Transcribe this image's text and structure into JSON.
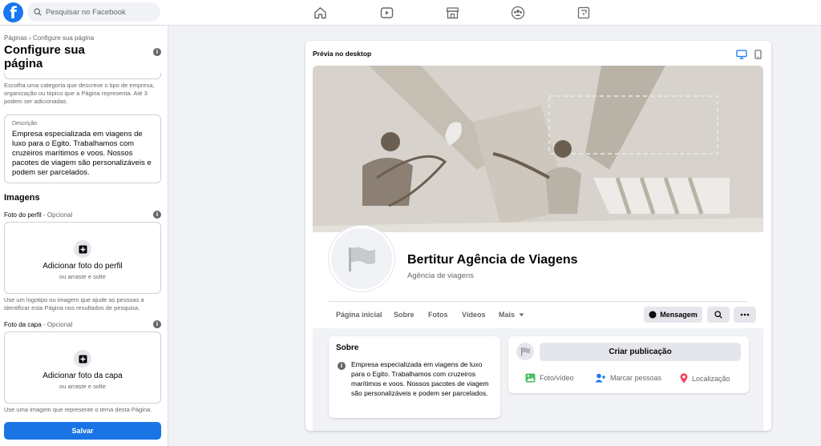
{
  "topbar": {
    "logo": "f",
    "search_placeholder": "Pesquisar no Facebook",
    "nav_icons": [
      "home-icon",
      "watch-icon",
      "marketplace-icon",
      "groups-icon",
      "gaming-icon"
    ]
  },
  "left_panel": {
    "breadcrumb": "Páginas › Configure sua página",
    "title": "Configure sua página",
    "category_helper": "Escolha uma categoria que descreve o tipo de empresa, organização ou tópico que a Página representa. Até 3 podem ser adicionadas.",
    "description": {
      "label": "Descrição",
      "value": "Empresa especializada em viagens de luxo para o Egito. Trabalhamos com cruzeiros marítimos e voos. Nossos pacotes de viagem são personalizáveis e podem ser parcelados."
    },
    "images_heading": "Imagens",
    "profile_photo": {
      "label": "Foto do perfil",
      "optional": " - Opcional",
      "button": "Adicionar foto do perfil",
      "sub": "ou arraste e solte",
      "helper": "Use um logotipo ou imagem que ajude as pessoas a identificar esta Página nos resultados de pesquisa."
    },
    "cover_photo": {
      "label": "Foto da capa",
      "optional": " - Opcional",
      "button": "Adicionar foto da capa",
      "sub": "ou arraste e solte",
      "helper": "Use uma imagem que represente o tema desta Página."
    },
    "save_label": "Salvar"
  },
  "preview": {
    "title": "Prévia no desktop",
    "page_name": "Bertitur Agência de Viagens",
    "page_category": "Agência de viagens",
    "tabs": [
      "Página inicial",
      "Sobre",
      "Fotos",
      "Vídeos",
      "Mais"
    ],
    "message_label": "Mensagem",
    "about": {
      "title": "Sobre",
      "text": "Empresa especializada em viagens de luxo para o Egito. Trabalhamos com cruzeiros marítimos e voos. Nossos pacotes de viagem são personalizáveis e podem ser parcelados."
    },
    "create_post": {
      "button": "Criar publicação",
      "actions": [
        "Foto/vídeo",
        "Marcar pessoas",
        "Localização"
      ]
    }
  },
  "colors": {
    "brand": "#1877f2",
    "save_button": "#1b74e4",
    "secondary_text": "#65676b",
    "cover_bg": "#d7d3cc"
  }
}
